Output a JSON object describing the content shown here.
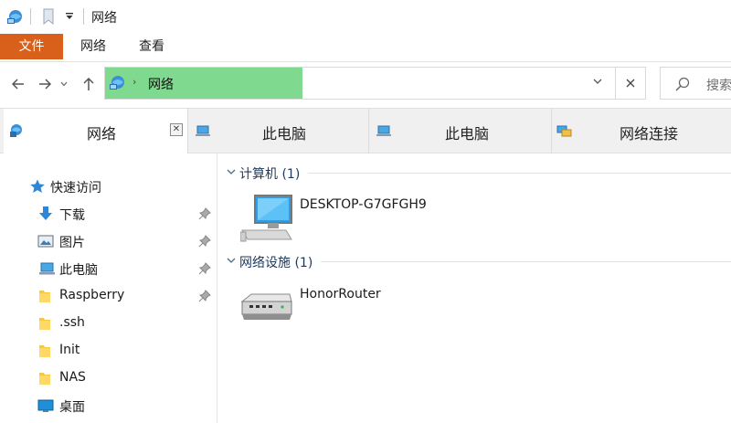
{
  "window": {
    "title": "网络"
  },
  "ribbon": {
    "tabs": [
      {
        "label": "文件"
      },
      {
        "label": "网络"
      },
      {
        "label": "查看"
      }
    ]
  },
  "address": {
    "location": "网络",
    "search_placeholder": "搜索"
  },
  "tabs": [
    {
      "label": "网络",
      "active": true
    },
    {
      "label": "此电脑",
      "active": false
    },
    {
      "label": "此电脑",
      "active": false
    },
    {
      "label": "网络连接",
      "active": false
    }
  ],
  "sidebar": {
    "quick_access": "快速访问",
    "items": [
      {
        "label": "下载",
        "icon": "download-icon",
        "pinned": true
      },
      {
        "label": "图片",
        "icon": "pictures-icon",
        "pinned": true
      },
      {
        "label": "此电脑",
        "icon": "computer-icon",
        "pinned": true
      },
      {
        "label": "Raspberry",
        "icon": "folder-icon",
        "pinned": true
      },
      {
        "label": ".ssh",
        "icon": "folder-icon",
        "pinned": false
      },
      {
        "label": "Init",
        "icon": "folder-icon",
        "pinned": false
      },
      {
        "label": "NAS",
        "icon": "folder-icon",
        "pinned": false
      },
      {
        "label": "桌面",
        "icon": "desktop-icon",
        "pinned": false
      }
    ]
  },
  "content": {
    "groups": [
      {
        "title": "计算机 (1)",
        "items": [
          {
            "label": "DESKTOP-G7GFGH9",
            "icon": "computer-monitor-icon"
          }
        ]
      },
      {
        "title": "网络设施 (1)",
        "items": [
          {
            "label": "HonorRouter",
            "icon": "router-icon"
          }
        ]
      }
    ]
  },
  "colors": {
    "file_tab": "#d9601a",
    "address_highlight": "#7fd98e",
    "group_title": "#1e395b"
  }
}
